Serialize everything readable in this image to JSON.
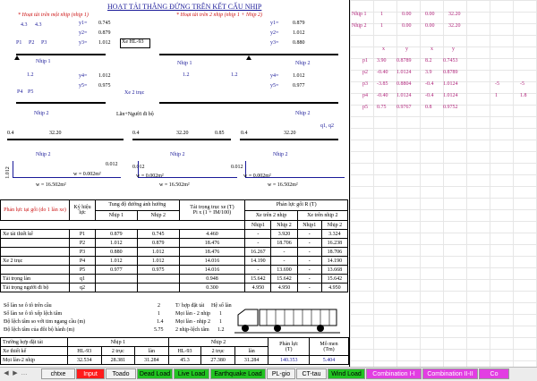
{
  "title": "HOẠT TẢI THẲNG ĐỨNG TRÊN KẾT CẤU NHỊP",
  "left_block": {
    "heading": "* Hoạt tải trên một nhịp (nhịp 1)",
    "y1": "y1=",
    "y1_val": "0.745",
    "y2": "y2=",
    "y2_val": "0.879",
    "y3": "y3=",
    "y3_val": "1.012",
    "spacing1": "4.3",
    "spacing2": "4.3",
    "p1": "P1",
    "p2": "P2",
    "p3": "P3",
    "span_label": "Nhịp 1",
    "y4": "y4=",
    "y4_val": "1.012",
    "y5": "y5=",
    "y5_val": "0.975",
    "p4": "P4",
    "p5": "P5",
    "d12": "1.2",
    "span_label2": "Nhịp 1",
    "car_label": "Xe HL-93",
    "tandem_label": "Xe 2 trục"
  },
  "right_block": {
    "heading": "* Hoạt tải trên 2 nhịp (nhịp 1 + Nhịp 2)",
    "y1": "y1=",
    "y1_val": "0.879",
    "y2": "y2=",
    "y2_val": "1.012",
    "y3": "y3=",
    "y3_val": "0.880",
    "span1": "Nhịp 1",
    "span2": "Nhịp 2",
    "d12a": "1.2",
    "d12b": "1.2",
    "y4": "y4=",
    "y4_val": "1.012",
    "y5": "y5=",
    "y5_val": "0.977"
  },
  "lane_section": {
    "label": "Lằn+Người đi bộ",
    "span2_a": "Nhịp 2",
    "span2_b": "Nhịp 2",
    "q_mark": "q1, q2",
    "v04a": "0.4",
    "v3220a": "32.20",
    "v04b": "0.4",
    "v3220b": "32.20",
    "v085": "0.85",
    "v04c": "0.4",
    "v3220c": "32.20",
    "v0012a": "0.012",
    "v0012b": "0.012",
    "v0012c": "0.012",
    "side": "1.012",
    "w_a": "w =",
    "w_a_val": "0.002m²",
    "w_b": "w =",
    "w_b_val": "16.502m²",
    "w_c": "w =",
    "w_c_val": "0.002m²",
    "w_d": "w =",
    "w_d_val": "16.502m²",
    "w_e": "w =",
    "w_e_val": "0.002m²",
    "w_f": "w =",
    "w_f_val": "16.502m²",
    "span2_c": "Nhịp 2",
    "span2_d": "Nhịp 2",
    "span2_e": "Nhịp 2"
  },
  "table": {
    "h_reaction": "Phản lực tại gối (do 1 làn xe)",
    "h_symbol": "Ký hiệu lực",
    "h_influence": "Tung độ đường ảnh hưởng",
    "h_axle": "Tải trọng trục xe (T)",
    "h_axle2": "Pi x (1 + IM/100)",
    "h_support": "Phản lực gối R (T)",
    "h_two": "Xe trên 2 nhịp",
    "h_one": "Xe trên nhịp 2",
    "h_n1": "Nhịp 1",
    "h_n2": "Nhịp 2",
    "h_sn1": "Nhịp1",
    "h_sn2": "Nhịp 2",
    "h_sn3": "Nhịp1",
    "h_sn4": "Nhịp 2",
    "rows": [
      {
        "label": "Xe tải thiết kế",
        "sym": "P1",
        "a": "0.879",
        "b": "0.745",
        "c": "4.460",
        "d": "-",
        "e": "3.920",
        "f": "-",
        "g": "3.324"
      },
      {
        "label": "",
        "sym": "P2",
        "a": "1.012",
        "b": "0.879",
        "c": "18.476",
        "d": "-",
        "e": "18.706",
        "f": "-",
        "g": "16.238"
      },
      {
        "label": "",
        "sym": "P3",
        "a": "0.880",
        "b": "1.012",
        "c": "18.476",
        "d": "16.267",
        "e": "-",
        "f": "-",
        "g": "18.706"
      },
      {
        "label": "Xe 2 trục",
        "sym": "P4",
        "a": "1.012",
        "b": "1.012",
        "c": "14.016",
        "d": "14.190",
        "e": "-",
        "f": "-",
        "g": "14.190"
      },
      {
        "label": "",
        "sym": "P5",
        "a": "0.977",
        "b": "0.975",
        "c": "14.016",
        "d": "-",
        "e": "13.690",
        "f": "-",
        "g": "13.668"
      },
      {
        "label": "Tải trọng làn",
        "sym": "q1",
        "a": "",
        "b": "",
        "c": "0.948",
        "d": "15.642",
        "e": "15.642",
        "f": "-",
        "g": "15.642"
      },
      {
        "label": "Tải trọng người đi bộ",
        "sym": "q2",
        "a": "",
        "b": "",
        "c": "0.300",
        "d": "4.950",
        "e": "4.950",
        "f": "-",
        "g": "4.950"
      }
    ]
  },
  "lanes": {
    "r1": "Số làn xe ô tô trên cầu",
    "r1v": "2",
    "r2": "Số làn xe ô tô xếp lệch tâm",
    "r2v": "1",
    "r3": "Độ lệch tâm so với tim ngang cầu (m)",
    "r3v": "1.4",
    "r4": "Độ lệch tâm của đôi bộ hành (m)",
    "r4v": "5.75",
    "t_head": "T/ hợp đặt tải",
    "k_head": "Hệ số làn",
    "t1": "Mọi làn - 2 nhịp",
    "k1": "1",
    "t2": "Mọi làn - nhịp 2",
    "k2": "1",
    "t3": "2 nhịp-lệch tâm",
    "k3": "1.2",
    "t4": "2 nhịp-lệch tâm",
    "k4": "1.2"
  },
  "bottom": {
    "case": "Trường hợp đặt tải",
    "n1": "Nhịp 1",
    "n2": "Nhịp 2",
    "xe": "Xe thiết kế",
    "hl": "HL-93",
    "tr": "2 trục",
    "ln": "làn",
    "hl2": "HL-93",
    "tr2": "2 trục",
    "ln2": "làn",
    "row_label": "Mọi làn-2 nhịp",
    "v1": "32.534",
    "v2": "28.381",
    "v3": "31.284",
    "v4": "45.3",
    "v5": "27.380",
    "v6": "31.284",
    "reaction": "Phản lực",
    "reaction_unit": "(T)",
    "reaction_val": "140.353",
    "moment": "Mô men",
    "moment_unit": "(Tm)",
    "moment_val": "5.404"
  },
  "right_table": {
    "rows": [
      {
        "a": "Nhịp 1",
        "b": "1",
        "c": "0.00",
        "d": "0.00",
        "e": "32.20"
      },
      {
        "a": "Nhịp 2",
        "b": "1",
        "c": "0.00",
        "d": "0.00",
        "e": "32.20"
      }
    ],
    "head": {
      "x1": "x",
      "y1": "y",
      "x2": "x",
      "y2": "y"
    },
    "prows": [
      {
        "p": "p1",
        "a": "3.90",
        "b": "0.8789",
        "c": "8.2",
        "d": "0.7453",
        "e": "",
        "f": ""
      },
      {
        "p": "p2",
        "a": "-0.40",
        "b": "1.0124",
        "c": "3.9",
        "d": "0.8789",
        "e": "",
        "f": ""
      },
      {
        "p": "p3",
        "a": "-3.85",
        "b": "0.8804",
        "c": "-0.4",
        "d": "1.0124",
        "e": "-5",
        "f": "-5"
      },
      {
        "p": "p4",
        "a": "-0.40",
        "b": "1.0124",
        "c": "-0.4",
        "d": "1.0124",
        "e": "1",
        "f": "1.8"
      },
      {
        "p": "p5",
        "a": "0.75",
        "b": "0.9767",
        "c": "0.8",
        "d": "0.9752",
        "e": "",
        "f": ""
      }
    ]
  },
  "tabs": [
    {
      "label": "chtxe",
      "bg": "#f2f2f2",
      "fg": "#000"
    },
    {
      "label": "Input",
      "bg": "#ff1b1b",
      "fg": "#fff"
    },
    {
      "label": "Toado",
      "bg": "#f2f2f2",
      "fg": "#000"
    },
    {
      "label": "Dead Load",
      "bg": "#22c322",
      "fg": "#000"
    },
    {
      "label": "Live Load",
      "bg": "#22c322",
      "fg": "#000"
    },
    {
      "label": "Earthquake Load",
      "bg": "#22c322",
      "fg": "#000"
    },
    {
      "label": "PL-gio",
      "bg": "#f2f2f2",
      "fg": "#000"
    },
    {
      "label": "CT-tau",
      "bg": "#f2f2f2",
      "fg": "#000"
    },
    {
      "label": "Wind Load",
      "bg": "#22c322",
      "fg": "#000"
    },
    {
      "label": "Combination I-I",
      "bg": "#e23ee2",
      "fg": "#fff"
    },
    {
      "label": "Combination II-II",
      "bg": "#e23ee2",
      "fg": "#fff"
    },
    {
      "label": "Co",
      "bg": "#e23ee2",
      "fg": "#fff"
    }
  ]
}
